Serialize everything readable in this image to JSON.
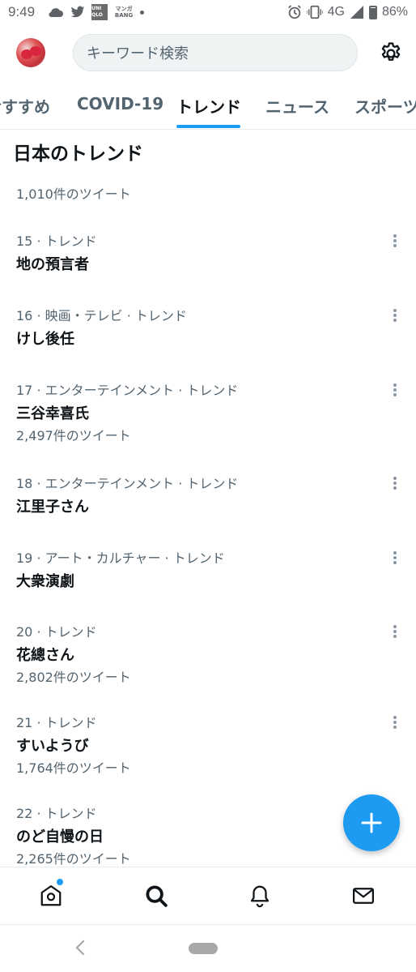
{
  "status_bar": {
    "time": "9:49",
    "network": "4G",
    "battery": "86%",
    "uniqlo_text": "UNI QLO",
    "manga_text": "マンガ BANG"
  },
  "header": {
    "search_placeholder": "キーワード検索"
  },
  "tabs": [
    {
      "label": "おすすめ",
      "active": false
    },
    {
      "label": "COVID-19",
      "active": false
    },
    {
      "label": "トレンド",
      "active": true
    },
    {
      "label": "ニュース",
      "active": false
    },
    {
      "label": "スポーツ",
      "active": false
    }
  ],
  "section_title": "日本のトレンド",
  "partial_item": {
    "count": "1,010件のツイート"
  },
  "trends": [
    {
      "meta": "15 · トレンド",
      "name": "地の預言者",
      "count": ""
    },
    {
      "meta": "16 · 映画・テレビ · トレンド",
      "name": "けし後任",
      "count": ""
    },
    {
      "meta": "17 · エンターテインメント · トレンド",
      "name": "三谷幸喜氏",
      "count": "2,497件のツイート"
    },
    {
      "meta": "18 · エンターテインメント · トレンド",
      "name": "江里子さん",
      "count": ""
    },
    {
      "meta": "19 · アート・カルチャー · トレンド",
      "name": "大衆演劇",
      "count": ""
    },
    {
      "meta": "20 · トレンド",
      "name": "花總さん",
      "count": "2,802件のツイート"
    },
    {
      "meta": "21 · トレンド",
      "name": "すいようび",
      "count": "1,764件のツイート"
    },
    {
      "meta": "22 · トレンド",
      "name": "のど自慢の日",
      "count": "2,265件のツイート"
    }
  ],
  "colors": {
    "accent": "#1d9bf0",
    "text_primary": "#0f1419",
    "text_secondary": "#536471"
  },
  "icons": {
    "fab": "plus-icon",
    "nav": [
      "home-icon",
      "search-icon",
      "bell-icon",
      "mail-icon"
    ]
  }
}
